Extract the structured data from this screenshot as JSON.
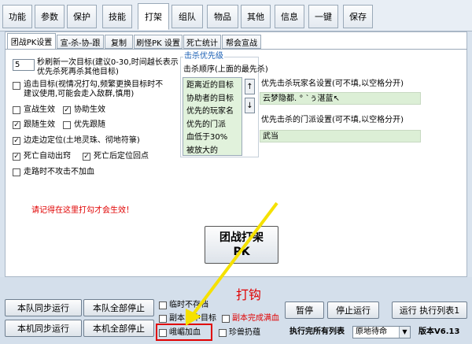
{
  "top_tabs": [
    "功能",
    "参数",
    "保护",
    "技能",
    "打架",
    "组队",
    "物品",
    "其他",
    "信息",
    "一键",
    "保存"
  ],
  "sub_tabs": [
    "团战PK设置",
    "宣-杀-协-跟",
    "复制",
    "刷怪PK 设置",
    "死亡统计",
    "帮会宣战"
  ],
  "refresh": {
    "value": "5",
    "line1": "秒刷新一次目标(建议0-30,时间越长表示",
    "line2": "优先杀死再杀其他目标)"
  },
  "options": {
    "chase_line1": "追击目标(视情况打勾,频繁更换目标时不",
    "chase_line2": "建议使用,可能会走入敌群,慎用)",
    "declare_war": "宣战生效",
    "assist": "协助生效",
    "follow": "跟随生效",
    "priority_follow": "优先跟随",
    "edge_walk": "边走边定位(土地灵珠、彻地符箓)",
    "death_exit": "死亡自动出窍",
    "death_back": "死亡后定位回点",
    "no_attack": "走路时不攻击不加血"
  },
  "kill_priority": {
    "group_title": "击杀优先级",
    "order_label": "击杀顺序(上面的最先杀)",
    "items": [
      "距离近的目标",
      "协助者的目标",
      "优先的玩家名",
      "优先的门派",
      "血低于30%",
      "被放大的"
    ],
    "up_arrow": "↑",
    "down_arrow": "↓"
  },
  "player_priority": {
    "label": "优先击杀玩家名设置(可不填,以空格分开)",
    "value": "云梦隐都. °  `ぅ湛蓝↖"
  },
  "faction_priority": {
    "label": "优先击杀的门派设置(可不填,以空格分开)",
    "value": "武当"
  },
  "warning_text": "请记得在这里打勾才会生效！",
  "pk_button": {
    "line1": "团战打架",
    "line2": "PK"
  },
  "annotation_text": "打钩",
  "bottom": {
    "btn_team_sync": "本队同步运行",
    "btn_team_stop": "本队全部停止",
    "btn_local_sync": "本机同步运行",
    "btn_local_stop": "本机全部停止",
    "cb_temp": "临时不存档",
    "cb_copy": "副本内中目标",
    "cb_copy_red": "副本完成满血",
    "cb_emei": "峨嵋加血",
    "cb_pet": "珍兽扔蕴",
    "btn_pause": "暂停",
    "btn_stop_run": "停止运行",
    "btn_run_list": "运行 执行列表1",
    "list_done_label": "执行完所有列表",
    "select_value": "原地待命",
    "version": "版本V6.13"
  },
  "colors": {
    "red": "#e00000",
    "yellow": "#f5e100",
    "green_field": "#dcefd6"
  }
}
